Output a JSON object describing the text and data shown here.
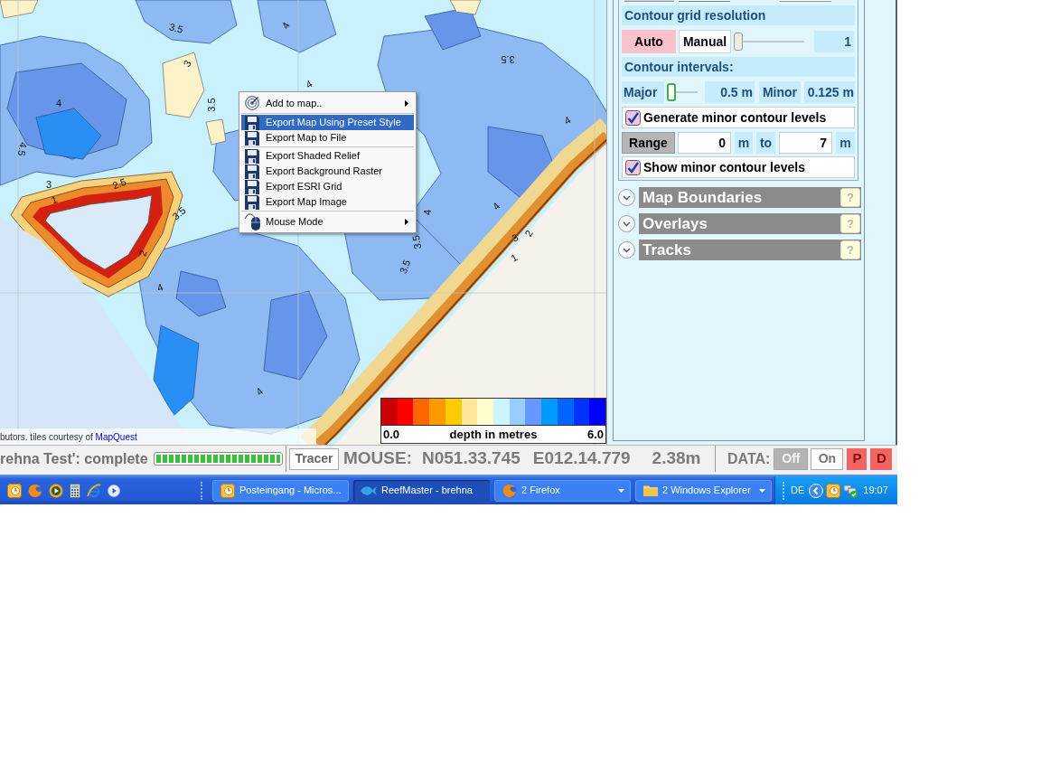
{
  "map": {
    "contour_labels": [
      "3.5",
      "4",
      "3",
      "4",
      "3.5",
      "4",
      "3.5",
      "4",
      "4.5",
      "3",
      "2.5",
      "1",
      "3.5",
      "4",
      "4",
      "2",
      "4",
      "3.5",
      "3.5",
      "3",
      "2",
      "1",
      "4"
    ],
    "attribution": {
      "text": "butors. tiles courtesy of",
      "link": "MapQuest"
    },
    "legend": {
      "swatches": [
        {
          "color": "#cc0000"
        },
        {
          "color": "#ff0000"
        },
        {
          "color": "#ff6600"
        },
        {
          "color": "#ff9900"
        },
        {
          "color": "#ffcc00"
        },
        {
          "color": "#ffe699"
        },
        {
          "color": "#ffffcc"
        },
        {
          "color": "#ccf5ff"
        },
        {
          "color": "#99ccff"
        },
        {
          "color": "#6699ff"
        },
        {
          "color": "#0099ff"
        },
        {
          "color": "#0066ff"
        },
        {
          "color": "#0033ff"
        },
        {
          "color": "#0000ff"
        }
      ],
      "min": "0.0",
      "title": "depth in metres",
      "max": "6.0"
    }
  },
  "context_menu": {
    "groups": [
      [
        {
          "kind": "target",
          "label": "Add to map..",
          "submenu": true,
          "selected": false
        }
      ],
      [
        {
          "kind": "disk",
          "label": "Export Map Using Preset Style",
          "submenu": false,
          "selected": true
        },
        {
          "kind": "disk",
          "label": "Export Map to File",
          "submenu": false,
          "selected": false
        }
      ],
      [
        {
          "kind": "disk",
          "label": "Export Shaded Relief",
          "submenu": false,
          "selected": false
        },
        {
          "kind": "disk",
          "label": "Export Background Raster",
          "submenu": false,
          "selected": false
        },
        {
          "kind": "disk",
          "label": "Export ESRI Grid",
          "submenu": false,
          "selected": false
        },
        {
          "kind": "disk",
          "label": "Export Map Image",
          "submenu": false,
          "selected": false
        }
      ],
      [
        {
          "kind": "mouse",
          "label": "Mouse Mode",
          "submenu": true,
          "selected": false
        }
      ]
    ]
  },
  "panel": {
    "grid_resolution": {
      "title": "Contour grid resolution",
      "modes": [
        {
          "label": "Auto",
          "selected": true
        },
        {
          "label": "Manual",
          "selected": false
        }
      ],
      "slider": {
        "level": 0
      },
      "value": "1"
    },
    "intervals": {
      "title": "Contour intervals:",
      "major_label": "Major",
      "major_slider": {
        "level": 0
      },
      "major_value": "0.5 m",
      "minor_label": "Minor",
      "minor_value": "0.125 m"
    },
    "generate_minor": {
      "label": "Generate minor contour levels",
      "checked": true
    },
    "range": {
      "button": "Range",
      "from": "0",
      "from_unit": "m",
      "to_label": "to",
      "to": "7",
      "to_unit": "m"
    },
    "show_minor": {
      "label": "Show minor contour levels",
      "checked": true
    },
    "sections": [
      {
        "title": "Map Boundaries",
        "expanded": false,
        "help": "?"
      },
      {
        "title": "Overlays",
        "expanded": false,
        "help": "?"
      },
      {
        "title": "Tracks",
        "expanded": false,
        "help": "?"
      }
    ]
  },
  "status_bar": {
    "task": "rehna Test': complete",
    "progress": {
      "level": 1
    },
    "tracer": "Tracer",
    "mouse_label": "MOUSE:",
    "latitude": "N051.33.745",
    "longitude": "E012.14.779",
    "depth": "2.38m",
    "data_label": "DATA:",
    "data_modes": [
      {
        "label": "Off",
        "selected": true
      },
      {
        "label": "On",
        "selected": false
      }
    ],
    "flags": [
      "P",
      "D"
    ]
  },
  "taskbar": {
    "tasks": [
      {
        "kind": "mail",
        "label": "Posteingang - Micros...",
        "grouped": false,
        "selected": false
      },
      {
        "kind": "fish",
        "label": "ReefMaster - brehna",
        "grouped": false,
        "selected": true
      },
      {
        "kind": "browser",
        "label": "2 Firefox",
        "grouped": true,
        "selected": false
      },
      {
        "kind": "folder",
        "label": "2 Windows Explorer",
        "grouped": true,
        "selected": false
      }
    ],
    "tray": {
      "language": "DE",
      "time": "19:07"
    }
  }
}
